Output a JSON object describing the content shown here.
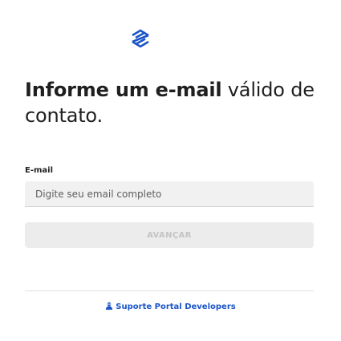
{
  "brand": {
    "logo_icon": "stacked-diamonds-logo",
    "color": "#1a55c9"
  },
  "headline": {
    "strong": "Informe um e-mail",
    "regular": " válido de contato."
  },
  "form": {
    "email_label": "E-mail",
    "email_value": "",
    "email_placeholder": "Digite seu email completo",
    "submit_label": "AVANÇAR",
    "submit_enabled": false
  },
  "footer": {
    "support_icon": "support-person-icon",
    "support_label": "Suporte Portal Developers"
  }
}
